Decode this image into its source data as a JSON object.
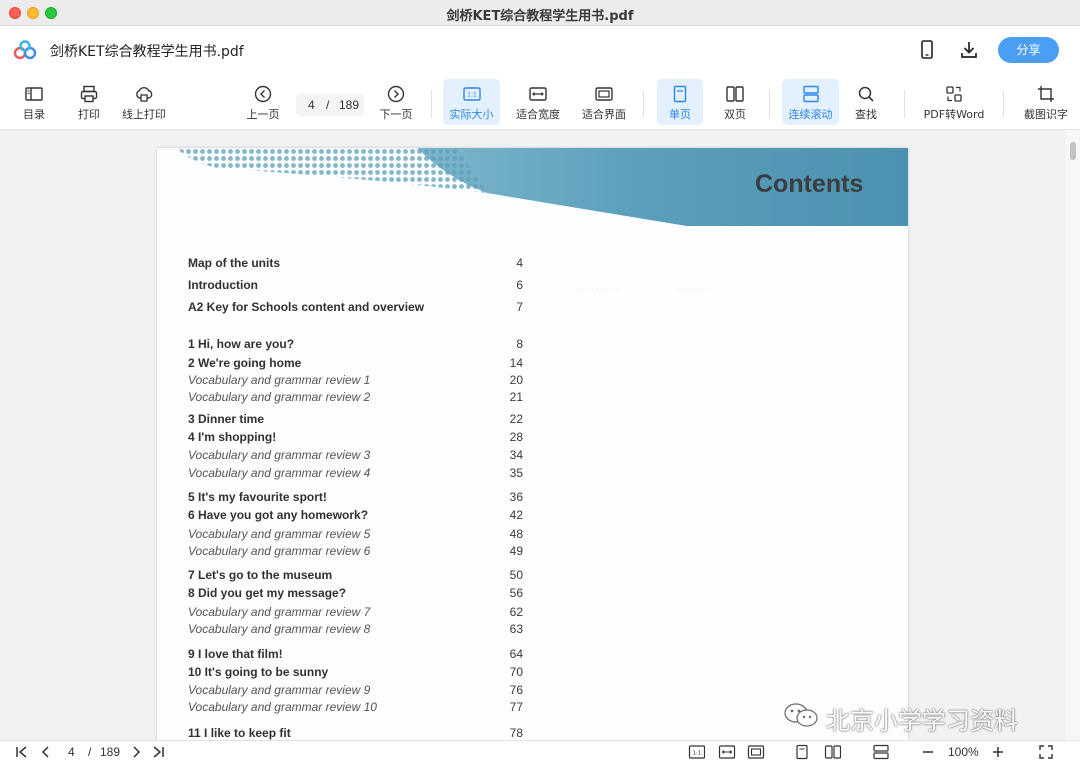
{
  "window": {
    "title": "剑桥KET综合教程学生用书.pdf"
  },
  "header": {
    "doc_title": "剑桥KET综合教程学生用书.pdf",
    "share_label": "分享"
  },
  "toolbar": {
    "toc": "目录",
    "print": "打印",
    "online_print": "线上打印",
    "prev": "上一页",
    "next": "下一页",
    "current_page": "4",
    "page_sep": "/",
    "total_pages": "189",
    "actual_size": "实际大小",
    "fit_width": "适合宽度",
    "fit_window": "适合界面",
    "single": "单页",
    "double": "双页",
    "continuous": "连续滚动",
    "find": "查找",
    "pdf_word": "PDF转Word",
    "ocr": "截图识字"
  },
  "document": {
    "heading": "Contents",
    "toc": [
      {
        "title": "Map of the units",
        "page": "4",
        "style": "bold"
      },
      {
        "title": "Introduction",
        "page": "6",
        "style": "bold"
      },
      {
        "title": "A2 Key for Schools content and overview",
        "page": "7",
        "style": "bold"
      },
      {
        "title": "1    Hi, how are you?",
        "page": "8",
        "style": "bold"
      },
      {
        "title": "2    We're going home",
        "page": "14",
        "style": "bold"
      },
      {
        "title": "Vocabulary and grammar review 1",
        "page": "20",
        "style": "ital"
      },
      {
        "title": "Vocabulary and grammar review 2",
        "page": "21",
        "style": "ital"
      },
      {
        "title": "3    Dinner time",
        "page": "22",
        "style": "bold"
      },
      {
        "title": "4    I'm shopping!",
        "page": "28",
        "style": "bold"
      },
      {
        "title": "Vocabulary and grammar review 3",
        "page": "34",
        "style": "ital"
      },
      {
        "title": "Vocabulary and grammar review 4",
        "page": "35",
        "style": "ital"
      },
      {
        "title": "5    It's my favourite sport!",
        "page": "36",
        "style": "bold"
      },
      {
        "title": "6    Have you got any homework?",
        "page": "42",
        "style": "bold"
      },
      {
        "title": "Vocabulary and grammar review 5",
        "page": "48",
        "style": "ital"
      },
      {
        "title": "Vocabulary and grammar review 6",
        "page": "49",
        "style": "ital"
      },
      {
        "title": "7    Let's go to the museum",
        "page": "50",
        "style": "bold"
      },
      {
        "title": "8    Did you get my message?",
        "page": "56",
        "style": "bold"
      },
      {
        "title": "Vocabulary and grammar review 7",
        "page": "62",
        "style": "ital"
      },
      {
        "title": "Vocabulary and grammar review 8",
        "page": "63",
        "style": "ital"
      },
      {
        "title": "9    I love that film!",
        "page": "64",
        "style": "bold"
      },
      {
        "title": "10  It's going to be sunny",
        "page": "70",
        "style": "bold"
      },
      {
        "title": "Vocabulary and grammar review 9",
        "page": "76",
        "style": "ital"
      },
      {
        "title": "Vocabulary and grammar review 10",
        "page": "77",
        "style": "ital"
      },
      {
        "title": "11  I like to keep fit",
        "page": "78",
        "style": "bold"
      }
    ]
  },
  "watermark": {
    "text": "北京小学学习资料"
  },
  "statusbar": {
    "current_page": "4",
    "sep": "/",
    "total_pages": "189",
    "zoom": "100%"
  },
  "colors": {
    "accent": "#4a9ff5",
    "banner": "#4f9ab8",
    "active_bg": "#e3f0fd"
  }
}
